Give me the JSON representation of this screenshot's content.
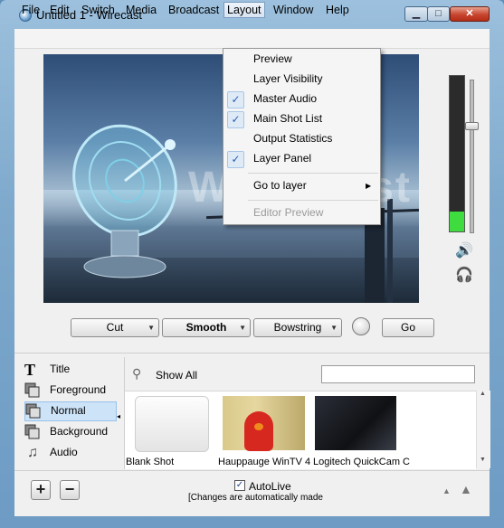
{
  "window": {
    "title": "Untitled 1 - Wirecast",
    "min_glyph": "▁",
    "max_glyph": "□",
    "close_glyph": "✕"
  },
  "menubar": {
    "items": [
      "File",
      "Edit",
      "Switch",
      "Media",
      "Broadcast",
      "Layout",
      "Window",
      "Help"
    ],
    "active": "Layout"
  },
  "layout_menu": {
    "items": [
      {
        "label": "Preview",
        "checked": false,
        "enabled": true
      },
      {
        "label": "Layer Visibility",
        "checked": false,
        "enabled": true
      },
      {
        "label": "Master Audio",
        "checked": true,
        "enabled": true
      },
      {
        "label": "Main Shot List",
        "checked": true,
        "enabled": true
      },
      {
        "label": "Output Statistics",
        "checked": false,
        "enabled": true
      },
      {
        "label": "Layer Panel",
        "checked": true,
        "enabled": true
      },
      {
        "label": "Go to layer",
        "checked": false,
        "enabled": true,
        "submenu": true
      },
      {
        "label": "Editor Preview",
        "checked": false,
        "enabled": false
      }
    ],
    "check_glyph": "✓",
    "submenu_glyph": "▶"
  },
  "preview": {
    "watermark_text": "Wi",
    "watermark_tail": "st"
  },
  "audio": {
    "meter_level": 0.13,
    "volume_level": 0.72,
    "speaker_icon": "🔊",
    "headphones_icon": "🎧"
  },
  "transitions": {
    "cut_label": "Cut",
    "smooth_label": "Smooth",
    "bowstring_label": "Bowstring",
    "go_label": "Go",
    "dropdown_glyph": "▼"
  },
  "layers": {
    "items": [
      "Title",
      "Foreground",
      "Normal",
      "Background",
      "Audio"
    ],
    "selected": "Normal"
  },
  "shots": {
    "show_all_label": "Show All",
    "search_value": "",
    "items": [
      "Blank Shot",
      "Hauppauge WinTV 4",
      "Logitech QuickCam C"
    ]
  },
  "footer": {
    "add_glyph": "+",
    "remove_glyph": "−",
    "autolive_label": "AutoLive",
    "autolive_checked": true,
    "autolive_note": "[Changes are automatically made",
    "check_glyph": "✓"
  },
  "colors": {
    "accent": "#2a5fb3",
    "selection": "#cde3f8",
    "meter_green": "#3fdc3f",
    "close_red": "#c8452f"
  }
}
